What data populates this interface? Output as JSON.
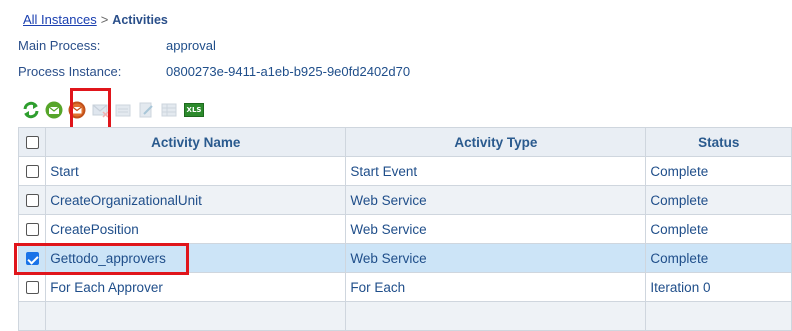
{
  "breadcrumb": {
    "link": "All Instances",
    "separator": ">",
    "current": "Activities"
  },
  "info": {
    "main_process_label": "Main Process:",
    "main_process_value": "approval",
    "instance_label": "Process Instance:",
    "instance_value": "0800273e-9411-a1eb-b925-9e0fd2402d70"
  },
  "toolbar": {
    "icons": [
      "refresh-icon",
      "email-green-icon",
      "email-orange-icon",
      "email-disabled-icon",
      "document-disabled-icon",
      "edit-disabled-icon",
      "grid-disabled-icon",
      "excel-export-icon"
    ],
    "excel_text": "XLS"
  },
  "table": {
    "headers": {
      "name": "Activity Name",
      "type": "Activity Type",
      "status": "Status"
    },
    "rows": [
      {
        "name": "Start",
        "type": "Start Event",
        "status": "Complete",
        "checked": false
      },
      {
        "name": "CreateOrganizationalUnit",
        "type": "Web Service",
        "status": "Complete",
        "checked": false
      },
      {
        "name": "CreatePosition",
        "type": "Web Service",
        "status": "Complete",
        "checked": false
      },
      {
        "name": "Gettodo_approvers",
        "type": "Web Service",
        "status": "Complete",
        "checked": true
      },
      {
        "name": "For Each Approver",
        "type": "For Each",
        "status": "Iteration 0",
        "checked": false
      }
    ]
  },
  "colors": {
    "highlight": "#e0151b",
    "selected_row": "#cce4f7",
    "complete": "#2a7a1a",
    "iteration": "#e0151b"
  }
}
